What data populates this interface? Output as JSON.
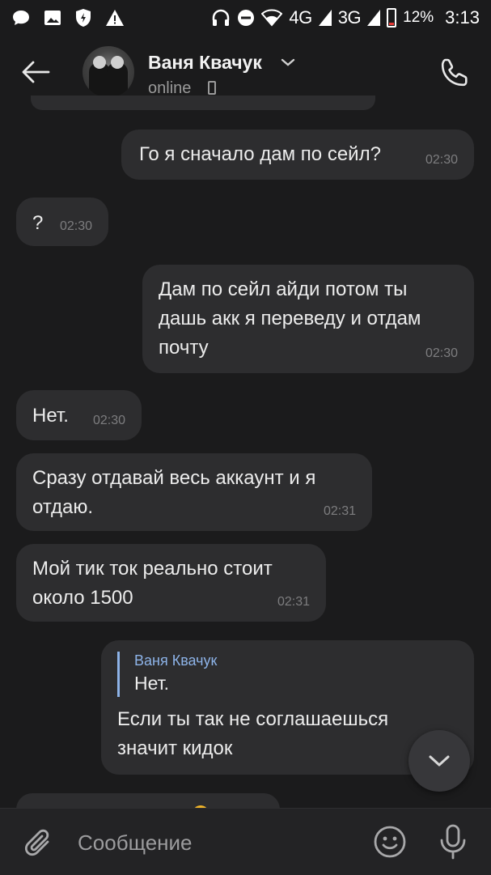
{
  "status_bar": {
    "network_4g": "4G",
    "network_3g": "3G",
    "battery": "12%",
    "time": "3:13",
    "icons": [
      "chat-icon",
      "image-icon",
      "shield-icon",
      "warning-icon",
      "headphones-icon",
      "dnd-icon",
      "wifi-icon",
      "signal-icon",
      "battery-icon"
    ]
  },
  "header": {
    "contact_name": "Ваня Квачук",
    "status": "online",
    "icons": [
      "back-arrow-icon",
      "chevron-down-icon",
      "mobile-icon",
      "phone-icon"
    ]
  },
  "messages": [
    {
      "side": "out",
      "text": "Го я сначало дам по сейл?",
      "time": "02:30"
    },
    {
      "side": "in",
      "text": "?",
      "time": "02:30"
    },
    {
      "side": "out",
      "text": "Дам по сейл айди потом ты дашь акк я переведу и отдам почту",
      "time": "02:30"
    },
    {
      "side": "in",
      "text": "Нет.",
      "time": "02:30"
    },
    {
      "side": "in",
      "text": "Сразу отдавай весь аккаунт и я отдаю.",
      "time": "02:31"
    },
    {
      "side": "in",
      "text": "Мой тик ток реально стоит около 1500",
      "time": "02:31"
    },
    {
      "side": "out",
      "reply_author": "Ваня Квачук",
      "reply_text": "Нет.",
      "text": "Если ты так не соглашаешься значит кидок",
      "time": ""
    }
  ],
  "composer": {
    "placeholder": "Сообщение",
    "icons": [
      "attach-icon",
      "emoji-icon",
      "mic-icon"
    ]
  },
  "colors": {
    "background": "#1b1b1c",
    "bubble": "#2d2d2f",
    "accent": "#8db3e8",
    "time_text": "#7d7d7f"
  }
}
